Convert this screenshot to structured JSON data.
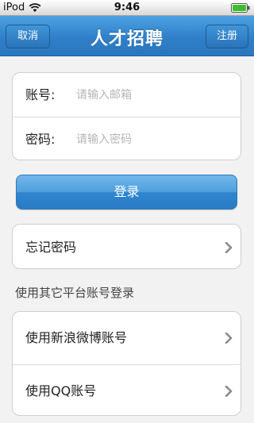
{
  "status_bar": {
    "carrier": "iPod",
    "time": "9:46",
    "wifi_icon": "wifi-icon",
    "battery_icon": "battery-icon"
  },
  "nav": {
    "cancel_label": "取消",
    "title": "人才招聘",
    "register_label": "注册",
    "accent_color": "#2f80c9"
  },
  "login_form": {
    "account_label": "账号:",
    "account_placeholder": "请输入邮箱",
    "account_value": "",
    "password_label": "密码:",
    "password_placeholder": "请输入密码",
    "password_value": ""
  },
  "login_button": {
    "label": "登录"
  },
  "forgot": {
    "label": "忘记密码",
    "chevron_icon": "chevron-right-icon"
  },
  "other_login": {
    "caption": "使用其它平台账号登录",
    "items": [
      {
        "label": "使用新浪微博账号",
        "icon": "chevron-right-icon"
      },
      {
        "label": "使用QQ账号",
        "icon": "chevron-right-icon"
      }
    ]
  }
}
